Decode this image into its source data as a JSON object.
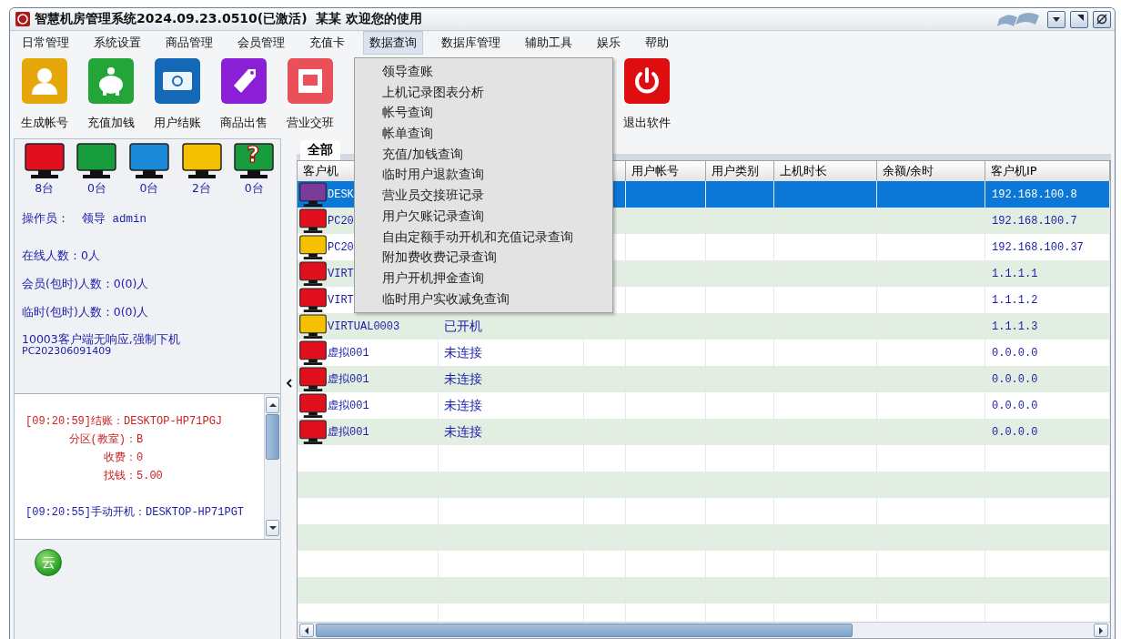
{
  "window": {
    "title": "智慧机房管理系统2024.09.23.0510(已激活)  某某 欢迎您的使用"
  },
  "menu": [
    {
      "label": "日常管理",
      "selected": false
    },
    {
      "label": "系统设置",
      "selected": false
    },
    {
      "label": "商品管理",
      "selected": false
    },
    {
      "label": "会员管理",
      "selected": false
    },
    {
      "label": "充值卡",
      "selected": false
    },
    {
      "label": "数据查询",
      "selected": true
    },
    {
      "label": "数据库管理",
      "selected": false
    },
    {
      "label": "辅助工具",
      "selected": false
    },
    {
      "label": "娱乐",
      "selected": false
    },
    {
      "label": "帮助",
      "selected": false
    }
  ],
  "dropdown": [
    "领导查账",
    "上机记录图表分析",
    "帐号查询",
    "帐单查询",
    "充值/加钱查询",
    "临时用户退款查询",
    "营业员交接班记录",
    "用户欠账记录查询",
    "自由定额手动开机和充值记录查询",
    "附加费收费记录查询",
    "用户开机押金查询",
    "临时用户实收减免查询"
  ],
  "toolbar": {
    "left": [
      {
        "label": "生成帐号",
        "kind": "user"
      },
      {
        "label": "充值加钱",
        "kind": "piggy"
      },
      {
        "label": "用户结账",
        "kind": "cash"
      },
      {
        "label": "商品出售",
        "kind": "sale"
      },
      {
        "label": "营业交班",
        "kind": "shop"
      }
    ],
    "right": [
      {
        "label": "退出软件",
        "kind": "power"
      }
    ]
  },
  "machine_counts": [
    {
      "count": "8台",
      "color": "#e0101f"
    },
    {
      "count": "0台",
      "color": "#169c3c"
    },
    {
      "count": "0台",
      "color": "#1a8ad8"
    },
    {
      "count": "2台",
      "color": "#f5c000"
    },
    {
      "count": "0台",
      "color": "#169c3c",
      "badge": "?"
    }
  ],
  "operator": {
    "label": "操作员：",
    "value": "领导 admin"
  },
  "stats": [
    "在线人数：0人",
    "会员(包时)人数：0(0)人",
    "临时(包时)人数：0(0)人"
  ],
  "notice": [
    "10003客户端无响应,强制下机",
    "PC202306091409"
  ],
  "log": [
    {
      "color": "#cc2020",
      "head": "[09:20:59]结账：DESKTOP-HP71PGJ",
      "fields": [
        {
          "label": "分区(教室)：",
          "value": "B"
        },
        {
          "label": "收费：",
          "value": "0"
        },
        {
          "label": "找钱：",
          "value": "5.00"
        }
      ]
    },
    {
      "color": "#1a1aa8",
      "head": "[09:20:55]手动开机：DESKTOP-HP71PGT"
    }
  ],
  "cloud_badge": "云",
  "tabs": [
    {
      "label": "全部",
      "selected": true
    }
  ],
  "columns": [
    {
      "label": "客户机"
    },
    {},
    {},
    {
      "label": "用户帐号"
    },
    {
      "label": "用户类别"
    },
    {
      "label": "上机时长"
    },
    {
      "label": "余额/余时"
    },
    {
      "label": "客户机IP"
    }
  ],
  "rows": [
    {
      "name": "DESK",
      "ip": "192.168.100.8",
      "color": "#7a3a9a",
      "selected": true
    },
    {
      "name": "PC20",
      "ip": "192.168.100.7",
      "color": "#e0101f",
      "selected": false
    },
    {
      "name": "PC20",
      "ip": "192.168.100.37",
      "color": "#f5c000",
      "selected": false
    },
    {
      "name": "VIRT",
      "ip": "1.1.1.1",
      "color": "#e0101f",
      "selected": false
    },
    {
      "name": "VIRT",
      "ip": "1.1.1.2",
      "color": "#e0101f",
      "selected": false
    },
    {
      "name": "VIRTUAL0003",
      "status": "已开机",
      "ip": "1.1.1.3",
      "color": "#f5c000",
      "selected": false
    },
    {
      "name": "虚拟001",
      "status": "未连接",
      "ip": "0.0.0.0",
      "color": "#e0101f",
      "selected": false
    },
    {
      "name": "虚拟001",
      "status": "未连接",
      "ip": "0.0.0.0",
      "color": "#e0101f",
      "selected": false
    },
    {
      "name": "虚拟001",
      "status": "未连接",
      "ip": "0.0.0.0",
      "color": "#e0101f",
      "selected": false
    },
    {
      "name": "虚拟001",
      "status": "未连接",
      "ip": "0.0.0.0",
      "color": "#e0101f",
      "selected": false
    }
  ]
}
